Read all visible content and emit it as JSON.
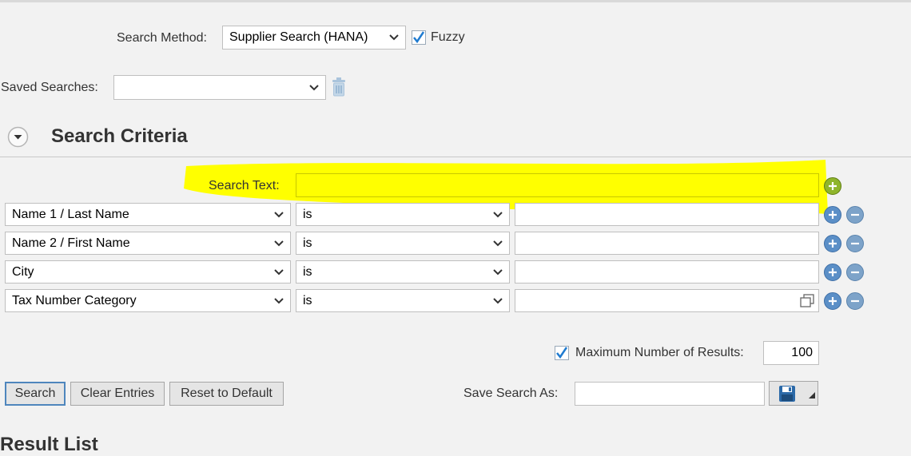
{
  "search_method": {
    "label": "Search Method:",
    "value": "Supplier Search (HANA)"
  },
  "fuzzy": {
    "label": "Fuzzy",
    "checked": true
  },
  "saved_searches": {
    "label": "Saved Searches:",
    "value": ""
  },
  "section": {
    "title": "Search Criteria"
  },
  "search_text": {
    "label": "Search Text:",
    "value": ""
  },
  "criteria_rows": [
    {
      "field": "Name 1 / Last Name",
      "operator": "is",
      "value": ""
    },
    {
      "field": "Name 2 / First Name",
      "operator": "is",
      "value": ""
    },
    {
      "field": "City",
      "operator": "is",
      "value": ""
    },
    {
      "field": "Tax Number Category",
      "operator": "is",
      "value": ""
    }
  ],
  "max_results": {
    "label": "Maximum Number of Results:",
    "value": "100",
    "checked": true
  },
  "buttons": {
    "search": "Search",
    "clear": "Clear Entries",
    "reset": "Reset to Default"
  },
  "save_search": {
    "label": "Save Search As:",
    "value": ""
  },
  "result_list": {
    "label": "Result List"
  },
  "colors": {
    "highlight": "#ffff00",
    "accent_blue": "#5b8fc7",
    "add_green": "#8fb52b"
  }
}
